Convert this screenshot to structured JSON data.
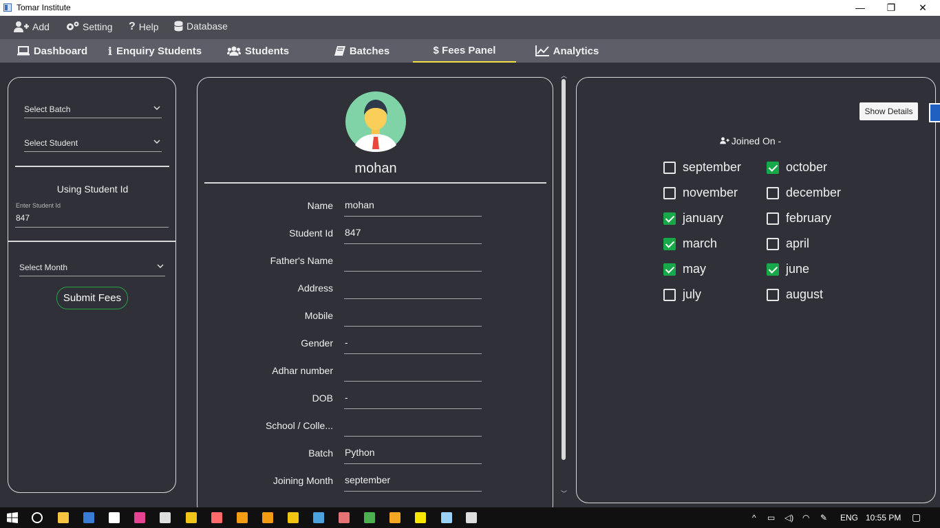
{
  "window": {
    "title": "Tomar Institute",
    "minimize": "—",
    "maximize": "❐",
    "close": "✕"
  },
  "menu": [
    {
      "label": "Add",
      "icon": "add-user-icon"
    },
    {
      "label": "Setting",
      "icon": "gears-icon"
    },
    {
      "label": "Help",
      "icon": "question-icon"
    },
    {
      "label": "Database",
      "icon": "database-icon"
    }
  ],
  "tabs": [
    {
      "label": "Dashboard",
      "icon": "laptop-icon"
    },
    {
      "label": "Enquiry Students",
      "icon": "info-icon"
    },
    {
      "label": "Students",
      "icon": "users-icon"
    },
    {
      "label": "Batches",
      "icon": "book-icon"
    },
    {
      "label": "$ Fees Panel",
      "icon": "dollar-icon",
      "active": true
    },
    {
      "label": "Analytics",
      "icon": "line-chart-icon"
    }
  ],
  "left": {
    "select_batch": "Select Batch",
    "select_student": "Select Student",
    "using_id_heading": "Using Student Id",
    "id_field_label": "Enter Student Id",
    "id_field_value": "847",
    "select_month": "Select Month",
    "submit": "Submit Fees"
  },
  "profile": {
    "name": "mohan",
    "fields": [
      {
        "label": "Name",
        "value": "mohan"
      },
      {
        "label": "Student Id",
        "value": "847"
      },
      {
        "label": "Father's Name",
        "value": ""
      },
      {
        "label": "Address",
        "value": ""
      },
      {
        "label": "Mobile",
        "value": ""
      },
      {
        "label": "Gender",
        "value": "-"
      },
      {
        "label": "Adhar number",
        "value": ""
      },
      {
        "label": "DOB",
        "value": "-"
      },
      {
        "label": "School / Colle...",
        "value": ""
      },
      {
        "label": "Batch",
        "value": "Python"
      },
      {
        "label": "Joining Month",
        "value": "september"
      }
    ]
  },
  "right": {
    "show_details": "Show Details",
    "joined_on": "Joined On -",
    "months": [
      {
        "label": "september",
        "checked": false
      },
      {
        "label": "october",
        "checked": true
      },
      {
        "label": "november",
        "checked": false
      },
      {
        "label": "december",
        "checked": false
      },
      {
        "label": "january",
        "checked": true
      },
      {
        "label": "february",
        "checked": false
      },
      {
        "label": "march",
        "checked": true
      },
      {
        "label": "april",
        "checked": false
      },
      {
        "label": "may",
        "checked": true
      },
      {
        "label": "june",
        "checked": true
      },
      {
        "label": "july",
        "checked": false
      },
      {
        "label": "august",
        "checked": false
      }
    ]
  },
  "taskbar": {
    "lang": "ENG",
    "time": "10:55 PM",
    "icons": [
      "windows-start-icon",
      "cortana-icon",
      "file-explorer-icon",
      "terminal-icon",
      "maps-icon",
      "paint-icon",
      "cmd-icon",
      "app-icon",
      "browser-icon",
      "vlc-icon",
      "sublime-icon",
      "mail-icon",
      "notepad-icon",
      "rocket-icon",
      "chrome-icon",
      "settings-app-icon",
      "sticky-notes-icon",
      "box-icon",
      "java-icon"
    ]
  },
  "colors": {
    "accent_tab": "#f2e04b",
    "check_green": "#17a84a",
    "panel_bg": "#2f3038"
  }
}
